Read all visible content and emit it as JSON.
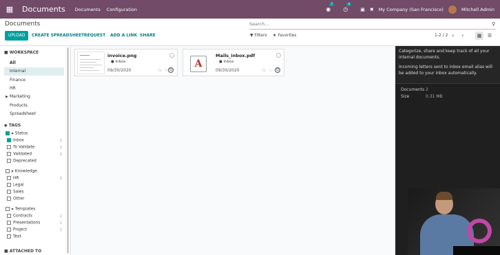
{
  "navbar": {
    "apps_icon": "grid-icon",
    "brand": "Documents",
    "menus": [
      "Documents",
      "Configuration"
    ],
    "chat_count": "7",
    "activity_count": "4",
    "company": "My Company (San Francisco)",
    "user": "Mitchell Admin"
  },
  "control_panel": {
    "breadcrumb": "Documents",
    "search_placeholder": "Search...",
    "buttons": {
      "upload": "UPLOAD",
      "create_spreadsheet": "CREATE SPREADSHEET",
      "request": "REQUEST",
      "add_link": "ADD A LINK",
      "share": "SHARE"
    },
    "filters": "Filters",
    "favorites": "Favorites",
    "pager": "1-2 / 2"
  },
  "sidebar": {
    "workspace_title": "WORKSPACE",
    "workspaces": [
      "All",
      "Internal",
      "Finance",
      "HR",
      "Marketing",
      "Products",
      "Spreadsheet"
    ],
    "tags_title": "TAGS",
    "status_group": "Status",
    "status_tags": [
      {
        "label": "Inbox",
        "count": "2",
        "checked": true
      },
      {
        "label": "To Validate",
        "count": "1",
        "checked": false
      },
      {
        "label": "Validated",
        "count": "0",
        "checked": false
      },
      {
        "label": "Deprecated",
        "count": "",
        "checked": false
      }
    ],
    "knowledge_group": "Knowledge",
    "knowledge_tags": [
      {
        "label": "HR",
        "count": "0"
      },
      {
        "label": "Legal",
        "count": ""
      },
      {
        "label": "Sales",
        "count": ""
      },
      {
        "label": "Other",
        "count": ""
      }
    ],
    "templates_group": "Templates",
    "template_tags": [
      {
        "label": "Contracts",
        "count": "2"
      },
      {
        "label": "Presentations",
        "count": "1"
      },
      {
        "label": "Project",
        "count": "1"
      },
      {
        "label": "Text",
        "count": ""
      }
    ],
    "attached_title": "ATTACHED TO"
  },
  "documents": [
    {
      "name": "invoice.png",
      "tag": "Inbox",
      "date": "09/30/2020",
      "type": "image"
    },
    {
      "name": "Mails_inbox.pdf",
      "tag": "Inbox",
      "date": "09/30/2020",
      "type": "pdf"
    }
  ],
  "inspector": {
    "intro": "Categorize, share and keep track of all your internal documents.",
    "intro2": "Incoming letters sent to inbox email alias will be added to your inbox automatically.",
    "documents_label": "Documents",
    "documents_value": "2",
    "size_label": "Size",
    "size_value": "0.31 MB"
  },
  "colors": {
    "navbar": "#714b67",
    "accent": "#00a09d",
    "link": "#017e84"
  }
}
